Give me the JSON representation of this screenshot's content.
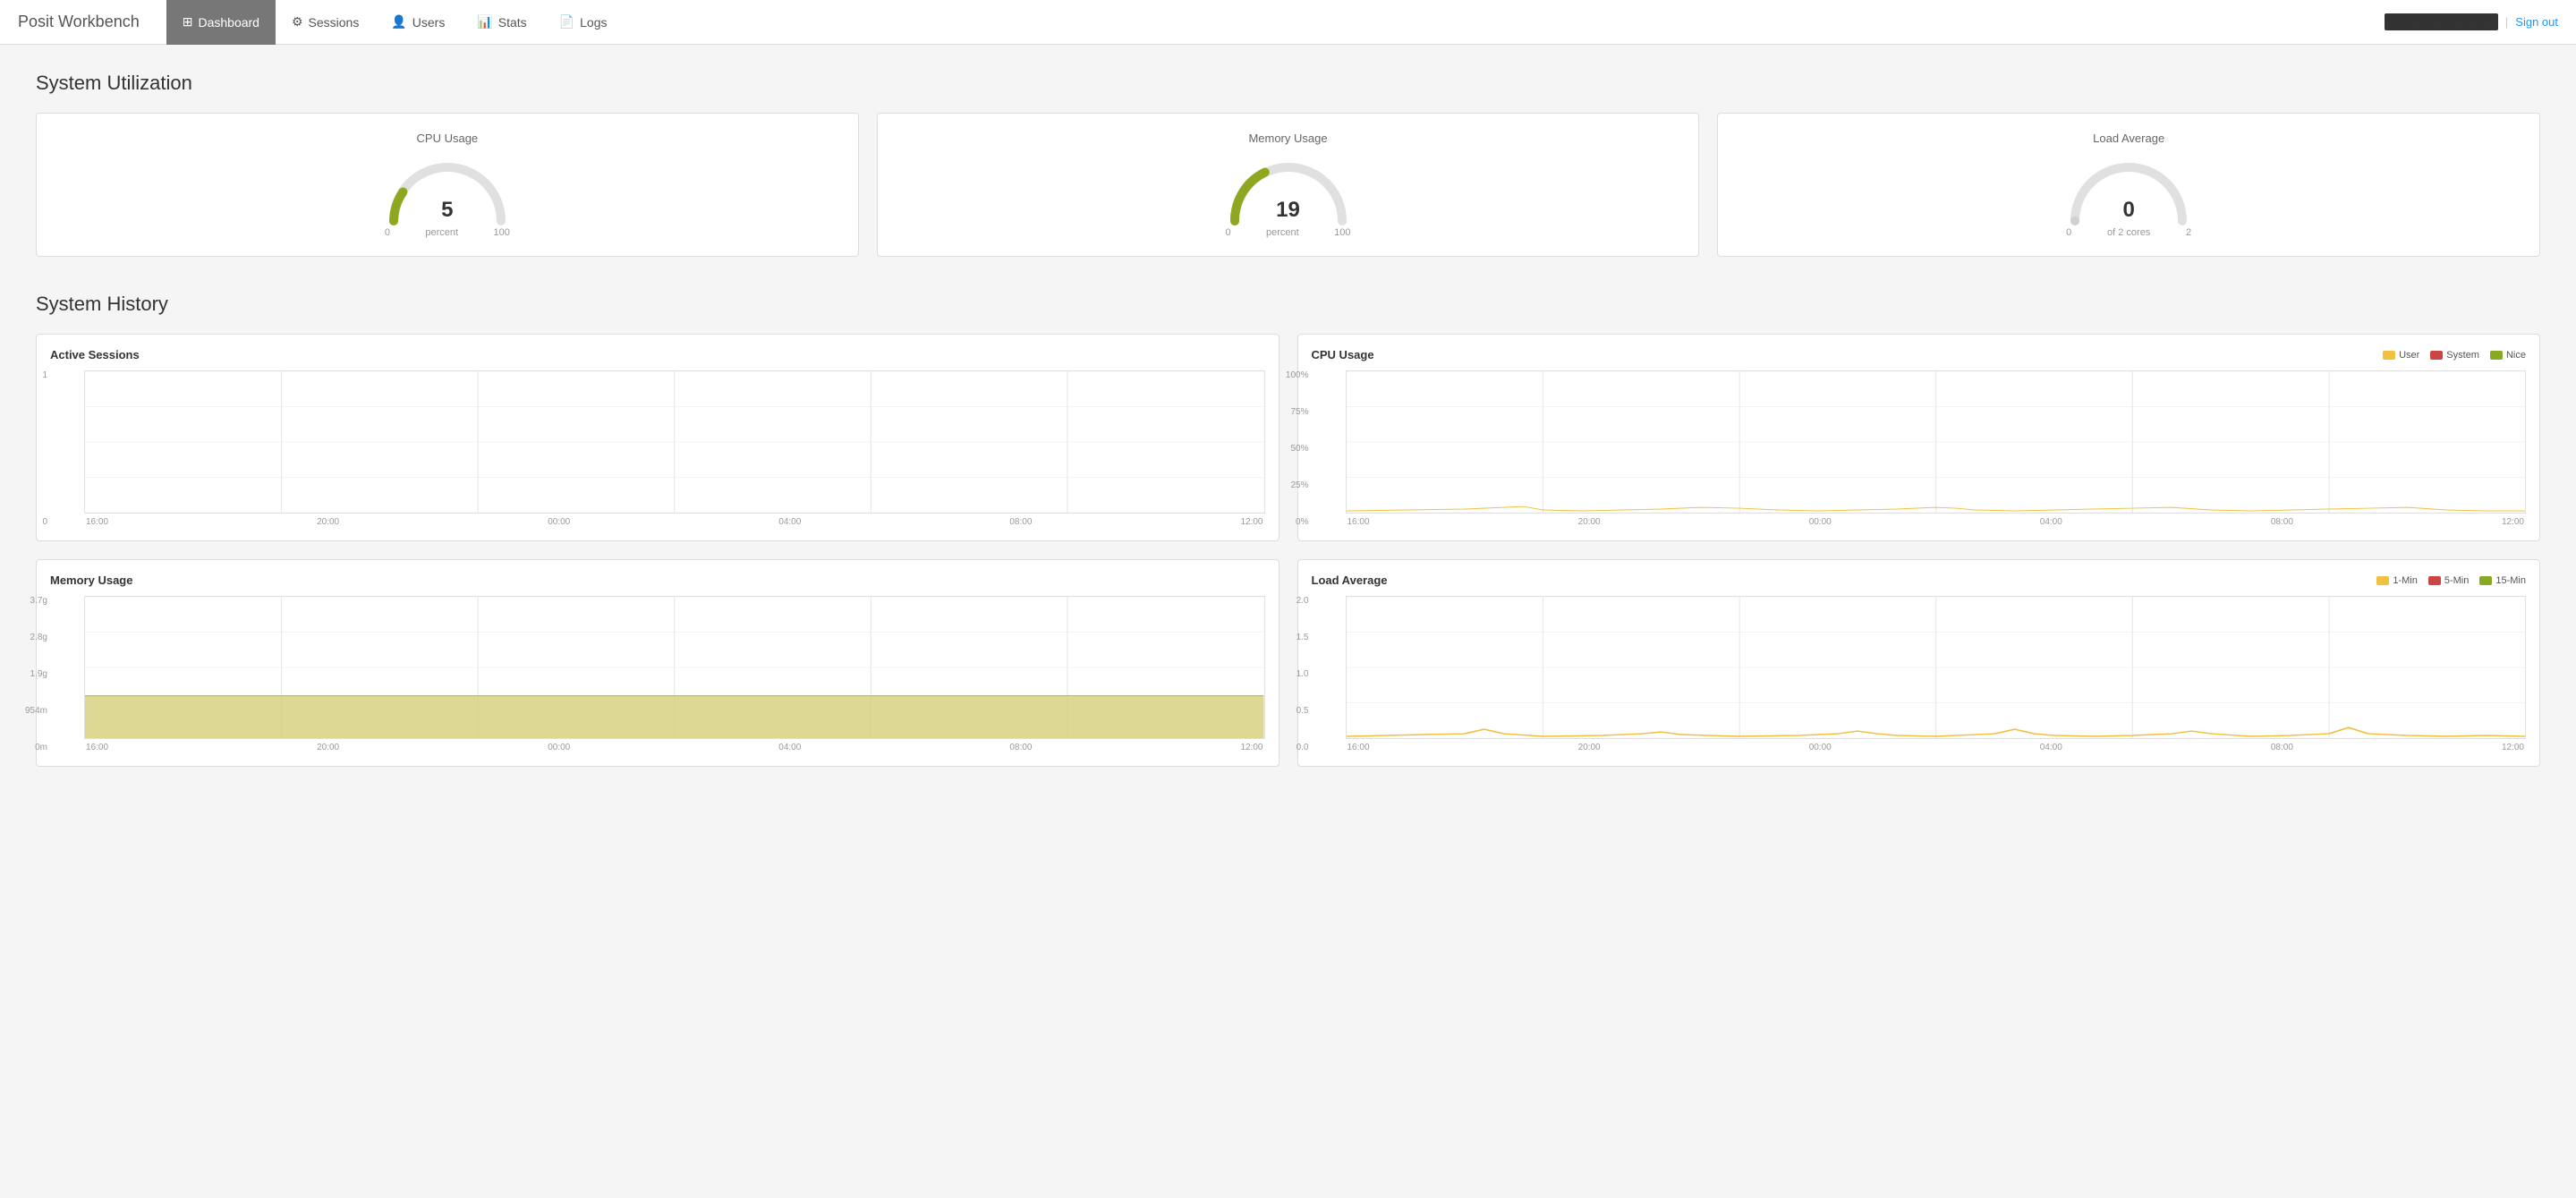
{
  "navbar": {
    "brand": "Posit Workbench",
    "tabs": [
      {
        "label": "Dashboard",
        "icon": "dashboard-icon",
        "active": true
      },
      {
        "label": "Sessions",
        "icon": "sessions-icon",
        "active": false
      },
      {
        "label": "Users",
        "icon": "users-icon",
        "active": false
      },
      {
        "label": "Stats",
        "icon": "stats-icon",
        "active": false
      },
      {
        "label": "Logs",
        "icon": "logs-icon",
        "active": false
      }
    ],
    "username": "████████████",
    "sign_out": "Sign out"
  },
  "system_utilization": {
    "title": "System Utilization",
    "cards": [
      {
        "title": "CPU Usage",
        "value": "5",
        "unit": "percent",
        "min": "0",
        "max": "100",
        "percent": 5,
        "color": "#8da820"
      },
      {
        "title": "Memory Usage",
        "value": "19",
        "unit": "percent",
        "min": "0",
        "max": "100",
        "percent": 19,
        "color": "#8da820"
      },
      {
        "title": "Load Average",
        "value": "0",
        "unit": "of 2 cores",
        "min": "0",
        "max": "2",
        "percent": 0,
        "color": "#8da820"
      }
    ]
  },
  "system_history": {
    "title": "System History",
    "charts": [
      {
        "id": "active-sessions",
        "title": "Active Sessions",
        "legend": [],
        "y_labels": [
          "1",
          "0"
        ],
        "x_labels": [
          "16:00",
          "20:00",
          "00:00",
          "04:00",
          "08:00",
          "12:00"
        ],
        "type": "line"
      },
      {
        "id": "cpu-usage",
        "title": "CPU Usage",
        "legend": [
          {
            "label": "User",
            "color": "#f0c040"
          },
          {
            "label": "System",
            "color": "#cc4444"
          },
          {
            "label": "Nice",
            "color": "#88aa22"
          }
        ],
        "y_labels": [
          "100%",
          "75%",
          "50%",
          "25%",
          "0%"
        ],
        "x_labels": [
          "16:00",
          "20:00",
          "00:00",
          "04:00",
          "08:00",
          "12:00"
        ],
        "type": "line"
      },
      {
        "id": "memory-usage-history",
        "title": "Memory Usage",
        "legend": [],
        "y_labels": [
          "3.7g",
          "2.8g",
          "1.9g",
          "954m",
          "0m"
        ],
        "x_labels": [
          "16:00",
          "20:00",
          "00:00",
          "04:00",
          "08:00",
          "12:00"
        ],
        "type": "area",
        "fill_color": "#d4d07a"
      },
      {
        "id": "load-average-history",
        "title": "Load Average",
        "legend": [
          {
            "label": "1-Min",
            "color": "#f0c040"
          },
          {
            "label": "5-Min",
            "color": "#cc4444"
          },
          {
            "label": "15-Min",
            "color": "#88aa22"
          }
        ],
        "y_labels": [
          "2.0",
          "1.5",
          "1.0",
          "0.5",
          "0.0"
        ],
        "x_labels": [
          "16:00",
          "20:00",
          "00:00",
          "04:00",
          "08:00",
          "12:00"
        ],
        "type": "line"
      }
    ]
  }
}
